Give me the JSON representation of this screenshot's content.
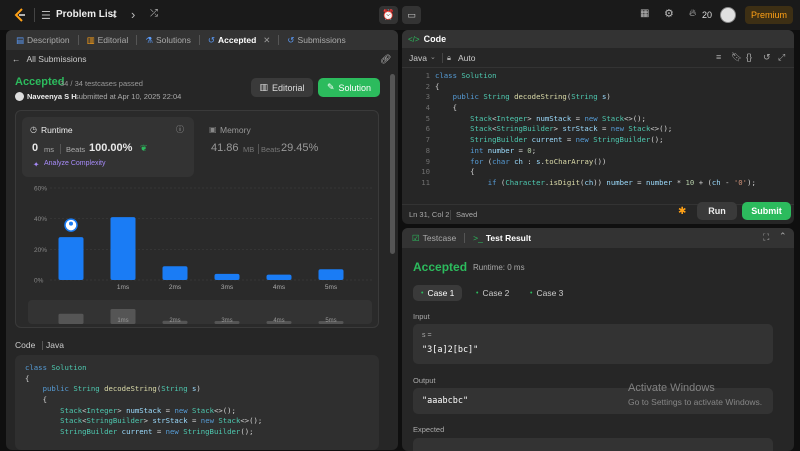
{
  "topbar": {
    "problem_list": "Problem List",
    "streak": "20",
    "premium": "Premium"
  },
  "left": {
    "tabs": [
      {
        "label": "Description"
      },
      {
        "label": "Editorial"
      },
      {
        "label": "Solutions"
      },
      {
        "label": "Accepted"
      },
      {
        "label": "Submissions"
      }
    ],
    "all_submissions": "All Submissions",
    "status": "Accepted",
    "testcases": "34 / 34 testcases passed",
    "user": "Naveenya S H",
    "submitted": "submitted at Apr 10, 2025 22:04",
    "editorial_btn": "Editorial",
    "solution_btn": "Solution",
    "runtime": {
      "label": "Runtime",
      "value": "0",
      "unit": "ms",
      "beats_label": "Beats",
      "beats": "100.00%",
      "analyze": "Analyze Complexity"
    },
    "memory": {
      "label": "Memory",
      "value": "41.86",
      "unit": "MB",
      "beats_label": "Beats",
      "beats": "29.45%"
    },
    "code_label": "Code",
    "lang": "Java",
    "code_lines": [
      [
        [
          "kw",
          "class "
        ],
        [
          "ty",
          "Solution"
        ]
      ],
      [
        [
          "df",
          "{"
        ]
      ],
      [
        [
          "df",
          "    "
        ],
        [
          "kw",
          "public "
        ],
        [
          "ty",
          "String "
        ],
        [
          "fn",
          "decodeString"
        ],
        [
          "df",
          "("
        ],
        [
          "ty",
          "String "
        ],
        [
          "vr",
          "s"
        ],
        [
          "df",
          ")"
        ]
      ],
      [
        [
          "df",
          "    {"
        ]
      ],
      [
        [
          "df",
          "        "
        ],
        [
          "ty",
          "Stack"
        ],
        [
          "df",
          "<"
        ],
        [
          "ty",
          "Integer"
        ],
        [
          "df",
          "> "
        ],
        [
          "vr",
          "numStack"
        ],
        [
          "df",
          " = "
        ],
        [
          "kw",
          "new "
        ],
        [
          "ty",
          "Stack"
        ],
        [
          "df",
          "<>();"
        ]
      ],
      [
        [
          "df",
          "        "
        ],
        [
          "ty",
          "Stack"
        ],
        [
          "df",
          "<"
        ],
        [
          "ty",
          "StringBuilder"
        ],
        [
          "df",
          "> "
        ],
        [
          "vr",
          "strStack"
        ],
        [
          "df",
          " = "
        ],
        [
          "kw",
          "new "
        ],
        [
          "ty",
          "Stack"
        ],
        [
          "df",
          "<>();"
        ]
      ],
      [
        [
          "df",
          "        "
        ],
        [
          "ty",
          "StringBuilder "
        ],
        [
          "vr",
          "current"
        ],
        [
          "df",
          " = "
        ],
        [
          "kw",
          "new "
        ],
        [
          "ty",
          "StringBuilder"
        ],
        [
          "df",
          "();"
        ]
      ]
    ]
  },
  "chart_data": {
    "type": "bar",
    "categories": [
      "",
      "1ms",
      "2ms",
      "3ms",
      "4ms",
      "5ms"
    ],
    "values": [
      28,
      41,
      9,
      4,
      3.5,
      7
    ],
    "ylim": [
      0,
      60
    ],
    "yticks": [
      "60%",
      "40%",
      "20%",
      "0%"
    ],
    "highlight_index": 0,
    "grid": true,
    "bar_color": "#1a7cf5"
  },
  "right": {
    "code_tab": "Code",
    "lang": "Java",
    "auto": "Auto",
    "code_lines": [
      [
        [
          "kw",
          "class "
        ],
        [
          "ty",
          "Solution"
        ]
      ],
      [
        [
          "df",
          "{"
        ]
      ],
      [
        [
          "df",
          "    "
        ],
        [
          "kw",
          "public "
        ],
        [
          "ty",
          "String "
        ],
        [
          "fn",
          "decodeString"
        ],
        [
          "df",
          "("
        ],
        [
          "ty",
          "String "
        ],
        [
          "vr",
          "s"
        ],
        [
          "df",
          ")"
        ]
      ],
      [
        [
          "df",
          "    {"
        ]
      ],
      [
        [
          "df",
          "        "
        ],
        [
          "ty",
          "Stack"
        ],
        [
          "df",
          "<"
        ],
        [
          "ty",
          "Integer"
        ],
        [
          "df",
          "> "
        ],
        [
          "vr",
          "numStack"
        ],
        [
          "df",
          " = "
        ],
        [
          "kw",
          "new "
        ],
        [
          "ty",
          "Stack"
        ],
        [
          "df",
          "<>();"
        ]
      ],
      [
        [
          "df",
          "        "
        ],
        [
          "ty",
          "Stack"
        ],
        [
          "df",
          "<"
        ],
        [
          "ty",
          "StringBuilder"
        ],
        [
          "df",
          "> "
        ],
        [
          "vr",
          "strStack"
        ],
        [
          "df",
          " = "
        ],
        [
          "kw",
          "new "
        ],
        [
          "ty",
          "Stack"
        ],
        [
          "df",
          "<>();"
        ]
      ],
      [
        [
          "df",
          "        "
        ],
        [
          "ty",
          "StringBuilder "
        ],
        [
          "vr",
          "current"
        ],
        [
          "df",
          " = "
        ],
        [
          "kw",
          "new "
        ],
        [
          "ty",
          "StringBuilder"
        ],
        [
          "df",
          "();"
        ]
      ],
      [
        [
          "df",
          "        "
        ],
        [
          "kw",
          "int "
        ],
        [
          "vr",
          "number"
        ],
        [
          "df",
          " = "
        ],
        [
          "nm",
          "0"
        ],
        [
          "df",
          ";"
        ]
      ],
      [
        [
          "df",
          "        "
        ],
        [
          "kw",
          "for "
        ],
        [
          "df",
          "("
        ],
        [
          "kw",
          "char "
        ],
        [
          "vr",
          "ch"
        ],
        [
          "df",
          " : "
        ],
        [
          "vr",
          "s"
        ],
        [
          "df",
          "."
        ],
        [
          "fn",
          "toCharArray"
        ],
        [
          "df",
          "())"
        ]
      ],
      [
        [
          "df",
          "        {"
        ]
      ],
      [
        [
          "df",
          "            "
        ],
        [
          "kw",
          "if "
        ],
        [
          "df",
          "("
        ],
        [
          "ty",
          "Character"
        ],
        [
          "df",
          "."
        ],
        [
          "fn",
          "isDigit"
        ],
        [
          "df",
          "("
        ],
        [
          "vr",
          "ch"
        ],
        [
          "df",
          ")) "
        ],
        [
          "vr",
          "number"
        ],
        [
          "df",
          " = "
        ],
        [
          "vr",
          "number"
        ],
        [
          "df",
          " * "
        ],
        [
          "nm",
          "10"
        ],
        [
          "df",
          " + ("
        ],
        [
          "vr",
          "ch"
        ],
        [
          "df",
          " - "
        ],
        [
          "st",
          "'0'"
        ],
        [
          "df",
          ");"
        ]
      ]
    ],
    "status": "Ln 31, Col 2",
    "saved": "Saved",
    "run": "Run",
    "submit": "Submit",
    "testcase_tab": "Testcase",
    "result_tab": "Test Result",
    "result_status": "Accepted",
    "result_runtime": "Runtime: 0 ms",
    "cases": [
      "Case 1",
      "Case 2",
      "Case 3"
    ],
    "input_label": "Input",
    "input_var": "s =",
    "input_val": "\"3[a]2[bc]\"",
    "output_label": "Output",
    "output_val": "\"aaabcbc\"",
    "expected_label": "Expected",
    "watermark1": "Activate Windows",
    "watermark2": "Go to Settings to activate Windows."
  },
  "colors": {
    "accent_green": "#2cbb5d",
    "accent_blue": "#1a7cf5",
    "premium": "#ffa116"
  }
}
